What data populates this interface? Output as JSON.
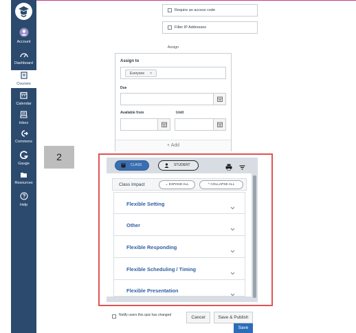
{
  "sidebar": {
    "items": [
      {
        "label": "Account",
        "icon": "account-icon"
      },
      {
        "label": "Dashboard",
        "icon": "dashboard-icon"
      },
      {
        "label": "Courses",
        "icon": "courses-icon"
      },
      {
        "label": "Calendar",
        "icon": "calendar-icon"
      },
      {
        "label": "Inbox",
        "icon": "inbox-icon"
      },
      {
        "label": "Commons",
        "icon": "commons-icon"
      },
      {
        "label": "Gauge",
        "icon": "gauge-icon"
      },
      {
        "label": "Resources",
        "icon": "resources-icon"
      },
      {
        "label": "Help",
        "icon": "help-icon"
      }
    ]
  },
  "settings": {
    "access_code_label": "Require an access code",
    "filter_ip_label": "Filter IP Addresses"
  },
  "assign": {
    "heading": "Assign",
    "assign_to_label": "Assign to",
    "assignee_tag": "Everyone",
    "remove_symbol": "×",
    "due_label": "Due",
    "available_from_label": "Available from",
    "until_label": "Until",
    "add_label": "+ Add"
  },
  "step_badge": "2",
  "extension": {
    "class_label": "CLASS",
    "student_label": "STUDENT",
    "impact_title": "Class Impact",
    "expand_all": "EXPAND ALL",
    "collapse_all": "COLLAPSE ALL",
    "sections": [
      "Flexible Setting",
      "Other",
      "Flexible Responding",
      "Flexible Scheduling / Timing",
      "Flexible Presentation"
    ]
  },
  "footer": {
    "notify_label": "Notify users this quiz has changed",
    "cancel_label": "Cancel",
    "save_publish_label": "Save & Publish",
    "save_label": "Save"
  },
  "colors": {
    "sidebar": "#2b4a6e",
    "highlight": "#e05252",
    "accordion_text": "#2e5fa0",
    "primary_button": "#2b6cb8"
  }
}
